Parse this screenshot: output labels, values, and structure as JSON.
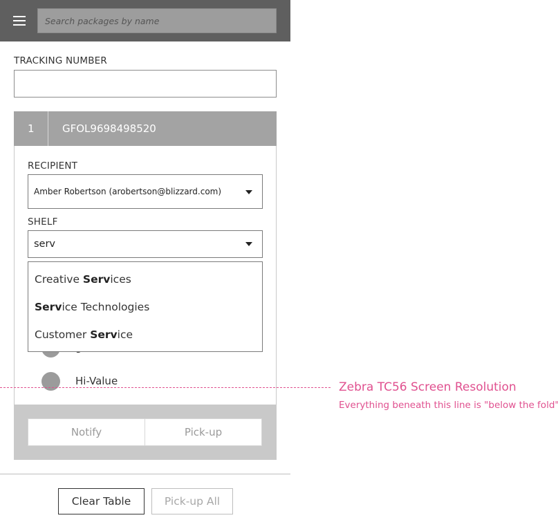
{
  "search": {
    "placeholder": "Search packages by name"
  },
  "tracking": {
    "label": "TRACKING NUMBER",
    "value": ""
  },
  "package": {
    "index": "1",
    "tracking_number": "GFOL9698498520",
    "recipient_label": "RECIPIENT",
    "recipient_value": "Amber Robertson  (arobertson@blizzard.com)",
    "shelf_label": "SHELF",
    "shelf_value": "serv",
    "shelf_options": [
      {
        "bold": "",
        "rest_before": "Creative ",
        "match": "Serv",
        "rest_after": "ices"
      },
      {
        "rest_before": "",
        "match": "Serv",
        "rest_after": "ice Technologies"
      },
      {
        "rest_before": "Customer ",
        "match": "Serv",
        "rest_after": "ice"
      }
    ],
    "radio_partial_label": "g",
    "radio_hivalue_label": "Hi-Value",
    "notify_label": "Notify",
    "pickup_label": "Pick-up"
  },
  "footer": {
    "clear_label": "Clear Table",
    "pickup_all_label": "Pick-up All"
  },
  "annotation": {
    "title": "Zebra TC56 Screen Resolution",
    "note": "Everything beneath this line is \"below the fold\"",
    "color": "#e0508f"
  },
  "colors": {
    "topbar": "#5f5f5f",
    "card_header": "#a3a3a3",
    "action_band": "#c9c9c9"
  }
}
